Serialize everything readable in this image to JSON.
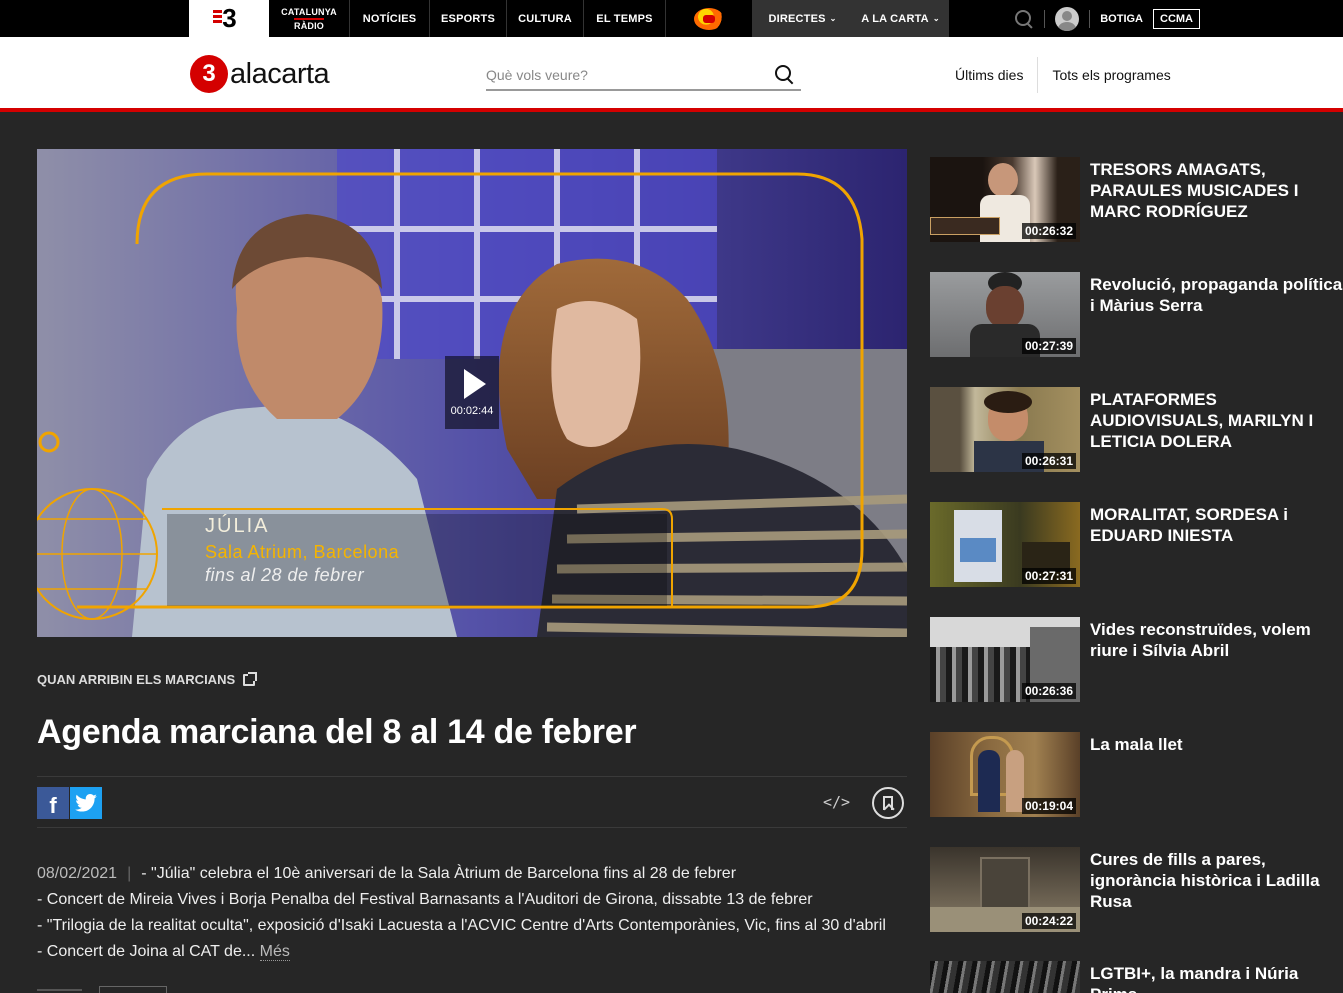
{
  "topbar": {
    "logo": "3",
    "radio_top": "CATALUNYA",
    "radio_bottom": "RÀDIO",
    "nav": [
      "NOTÍCIES",
      "ESPORTS",
      "CULTURA",
      "EL TEMPS"
    ],
    "directes": "DIRECTES",
    "alacarta": "A LA CARTA",
    "botiga": "BOTIGA",
    "ccma": "CCMA",
    "icons": [
      "search-icon",
      "user-avatar-icon",
      "chevron-down-icon"
    ]
  },
  "header": {
    "brand_num": "3",
    "brand_text": "alacarta",
    "search_placeholder": "Què vols veure?",
    "nav": [
      "Últims dies",
      "Tots els programes"
    ]
  },
  "player": {
    "duration": "00:02:44",
    "overlay_name": "JÚLIA",
    "overlay_place": "Sala Atrium, Barcelona",
    "overlay_dates": "fins al 28 de febrer"
  },
  "video": {
    "program": "QUAN ARRIBIN ELS MARCIANS",
    "title": "Agenda marciana del 8 al 14 de febrer",
    "date": "08/02/2021",
    "lines": [
      "- \"Júlia\" celebra el 10è aniversari de la Sala Àtrium de Barcelona fins al 28 de febrer",
      "- Concert de Mireia Vives i Borja Penalba del Festival Barnasants a l'Auditori de Girona, dissabte 13 de febrer",
      "- \"Trilogia de la realitat oculta\", exposició d'Isaki Lacuesta a l'ACVIC Centre d'Arts Contemporànies, Vic, fins al 30 d'abril",
      "- Concert de Joina al CAT de..."
    ],
    "more": "Més",
    "facebook": "f",
    "embed": "</>"
  },
  "colors": {
    "brand_red": "#d40000",
    "facebook": "#3b5998",
    "twitter": "#1da1f2",
    "background": "#262626"
  },
  "related": [
    {
      "title": "TRESORS AMAGATS, PARAULES MUSICADES I MARC RODRÍGUEZ",
      "duration": "00:26:32"
    },
    {
      "title": "Revolució, propaganda política i Màrius Serra",
      "duration": "00:27:39"
    },
    {
      "title": "PLATAFORMES AUDIOVISUALS, MARILYN I LETICIA DOLERA",
      "duration": "00:26:31"
    },
    {
      "title": "MORALITAT, SORDESA i EDUARD INIESTA",
      "duration": "00:27:31"
    },
    {
      "title": "Vides reconstruïdes, volem riure i Sílvia Abril",
      "duration": "00:26:36"
    },
    {
      "title": "La mala llet",
      "duration": "00:19:04"
    },
    {
      "title": "Cures de fills a pares, ignorància històrica i Ladilla Rusa",
      "duration": "00:24:22"
    },
    {
      "title": "LGTBI+, la mandra i Núria Prims",
      "duration": ""
    }
  ]
}
